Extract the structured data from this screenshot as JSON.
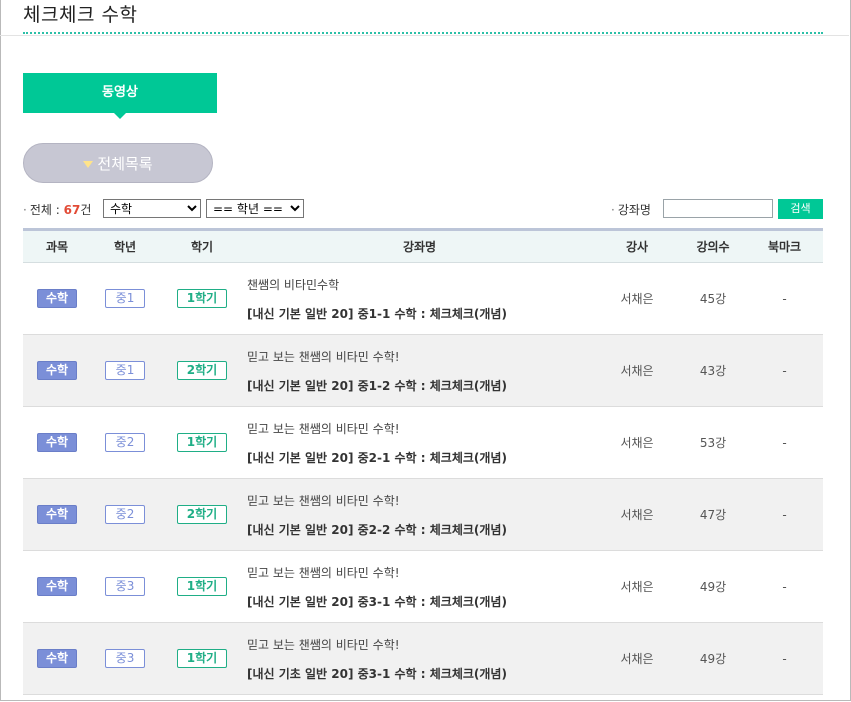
{
  "page": {
    "title": "체크체크 수학"
  },
  "tabs": {
    "video": "동영상"
  },
  "all_list_button": "전체목록",
  "filter": {
    "total_label": "전체 :",
    "total_count": "67",
    "total_unit": "건",
    "subject_selected": "수학",
    "grade_selected": "== 학년 ==",
    "search_label": "강좌명",
    "search_value": "",
    "search_button": "검색"
  },
  "table": {
    "headers": [
      "과목",
      "학년",
      "학기",
      "강좌명",
      "강사",
      "강의수",
      "북마크"
    ],
    "rows": [
      {
        "subject": "수학",
        "grade": "중1",
        "term": "1학기",
        "title_sub": "챈쌤의 비타민수학",
        "title_main": "[내신 기본 일반 20] 중1-1 수학 : 체크체크(개념)",
        "teacher": "서채은",
        "lectures": "45강",
        "bookmark": "-"
      },
      {
        "subject": "수학",
        "grade": "중1",
        "term": "2학기",
        "title_sub": "믿고 보는 챈쌤의 비타민 수학!",
        "title_main": "[내신 기본 일반 20] 중1-2 수학 : 체크체크(개념)",
        "teacher": "서채은",
        "lectures": "43강",
        "bookmark": "-"
      },
      {
        "subject": "수학",
        "grade": "중2",
        "term": "1학기",
        "title_sub": "믿고 보는 챈쌤의 비타민 수학!",
        "title_main": "[내신 기본 일반 20] 중2-1 수학 : 체크체크(개념)",
        "teacher": "서채은",
        "lectures": "53강",
        "bookmark": "-"
      },
      {
        "subject": "수학",
        "grade": "중2",
        "term": "2학기",
        "title_sub": "믿고 보는 챈쌤의 비타민 수학!",
        "title_main": "[내신 기본 일반 20] 중2-2 수학 : 체크체크(개념)",
        "teacher": "서채은",
        "lectures": "47강",
        "bookmark": "-"
      },
      {
        "subject": "수학",
        "grade": "중3",
        "term": "1학기",
        "title_sub": "믿고 보는 챈쌤의 비타민 수학!",
        "title_main": "[내신 기본 일반 20] 중3-1 수학 : 체크체크(개념)",
        "teacher": "서채은",
        "lectures": "49강",
        "bookmark": "-"
      },
      {
        "subject": "수학",
        "grade": "중3",
        "term": "1학기",
        "title_sub": "믿고 보는 챈쌤의 비타민 수학!",
        "title_main": "[내신 기초 일반 20] 중3-1 수학 : 체크체크(개념)",
        "teacher": "서채은",
        "lectures": "49강",
        "bookmark": "-"
      }
    ]
  },
  "colors": {
    "accent": "#00c896",
    "badge_blue": "#7b8fd8",
    "term_green": "#1fae86",
    "count_red": "#e24b36"
  }
}
